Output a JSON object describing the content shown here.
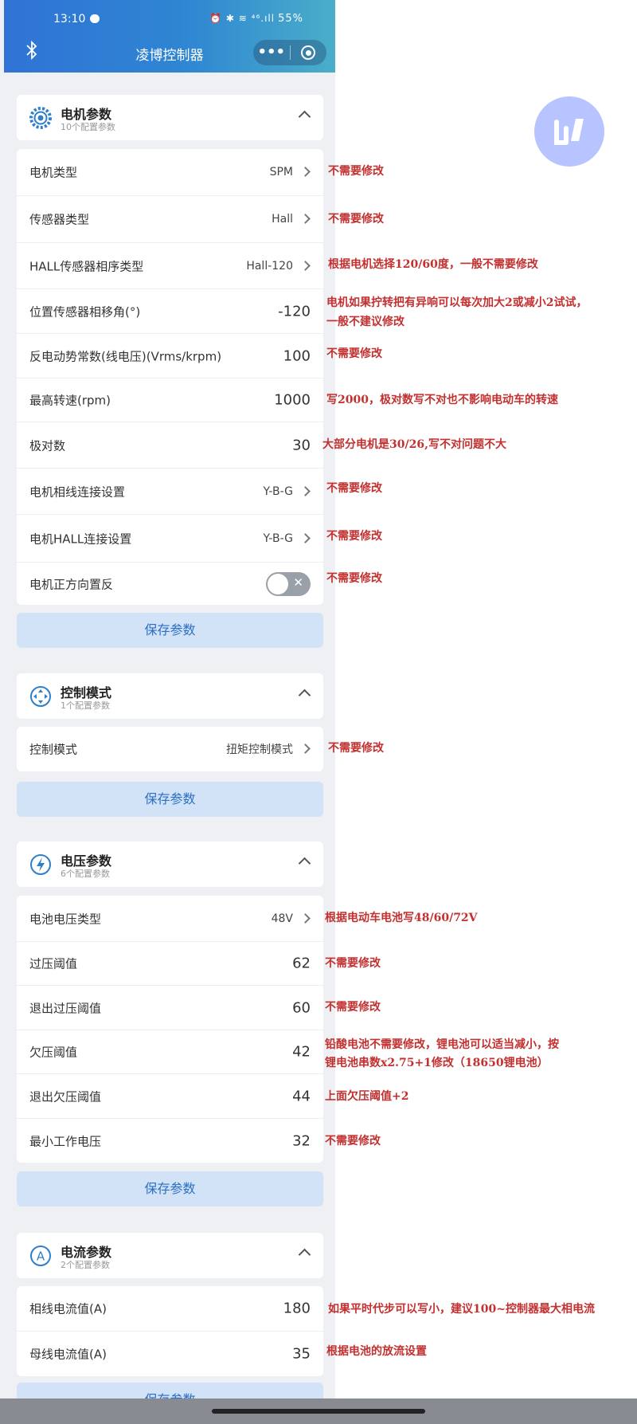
{
  "status": {
    "time": "13:10",
    "icons": "⏰ ✱ ≋ ⁴⁶.ıll",
    "battery": "55%"
  },
  "header": {
    "title": "凌博控制器",
    "menu_dots": "•••"
  },
  "sections": {
    "motor": {
      "title": "电机参数",
      "subtitle": "10个配置参数",
      "save": "保存参数",
      "rows": [
        {
          "label": "电机类型",
          "value": "SPM"
        },
        {
          "label": "传感器类型",
          "value": "Hall"
        },
        {
          "label": "HALL传感器相序类型",
          "value": "Hall-120"
        },
        {
          "label": "位置传感器相移角(°)",
          "value": "-120"
        },
        {
          "label": "反电动势常数(线电压)(Vrms/krpm)",
          "value": "100"
        },
        {
          "label": "最高转速(rpm)",
          "value": "1000"
        },
        {
          "label": "极对数",
          "value": "30"
        },
        {
          "label": "电机相线连接设置",
          "value": "Y-B-G"
        },
        {
          "label": "电机HALL连接设置",
          "value": "Y-B-G"
        },
        {
          "label": "电机正方向置反",
          "toggle": false
        }
      ]
    },
    "control": {
      "title": "控制模式",
      "subtitle": "1个配置参数",
      "save": "保存参数",
      "rows": [
        {
          "label": "控制模式",
          "value": "扭矩控制模式"
        }
      ]
    },
    "voltage": {
      "title": "电压参数",
      "subtitle": "6个配置参数",
      "save": "保存参数",
      "rows": [
        {
          "label": "电池电压类型",
          "value": "48V"
        },
        {
          "label": "过压阈值",
          "value": "62"
        },
        {
          "label": "退出过压阈值",
          "value": "60"
        },
        {
          "label": "欠压阈值",
          "value": "42"
        },
        {
          "label": "退出欠压阈值",
          "value": "44"
        },
        {
          "label": "最小工作电压",
          "value": "32"
        }
      ]
    },
    "current": {
      "title": "电流参数",
      "subtitle": "2个配置参数",
      "save": "保存参数",
      "rows": [
        {
          "label": "相线电流值(A)",
          "value": "180"
        },
        {
          "label": "母线电流值(A)",
          "value": "35"
        }
      ]
    }
  },
  "notes": [
    "不需要修改",
    "不需要修改",
    "根据电机选择120/60度，一般不需要修改",
    "电机如果拧转把有异响可以每次加大2或减小2试试，",
    "一般不建议修改",
    "不需要修改",
    "写2000，极对数写不对也不影响电动车的转速",
    "大部分电机是30/26,写不对问题不大",
    "不需要修改",
    "不需要修改",
    "不需要修改",
    "不需要修改",
    "根据电动车电池写48/60/72V",
    "不需要修改",
    "不需要修改",
    "铅酸电池不需要修改，锂电池可以适当减小，按",
    "锂电池串数x2.75+1修改（18650锂电池）",
    "上面欠压阈值+2",
    "不需要修改",
    "如果平时代步可以写小，建议100~控制器最大相电流",
    "根据电池的放流设置"
  ],
  "colors": {
    "header_start": "#2f73d6",
    "header_end": "#4aaec9",
    "note": "#c23030",
    "save_bg": "#d2e3f7",
    "save_text": "#2a6fc4"
  }
}
